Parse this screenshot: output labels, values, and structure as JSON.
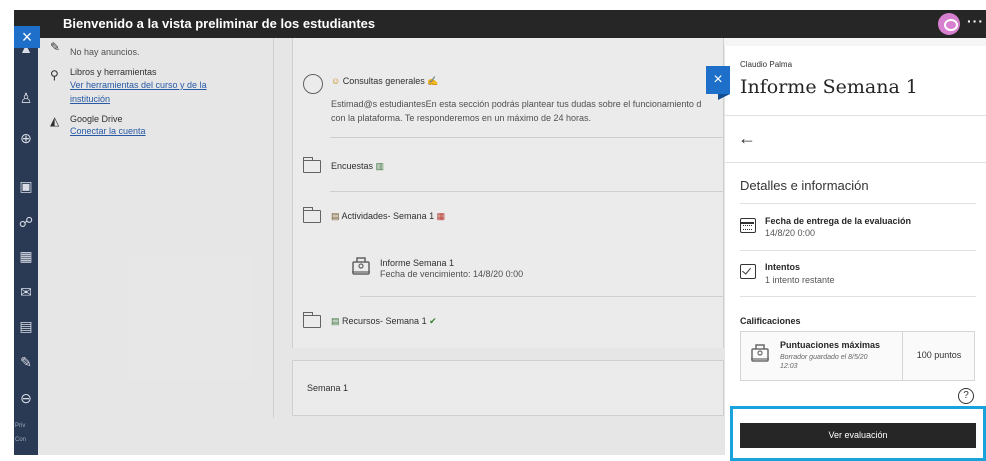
{
  "topbar": {
    "title": "Bienvenido a la vista preliminar de los estudiantes",
    "close_label": "×",
    "more_label": "···"
  },
  "leftnav": {
    "footer_1": "Priv",
    "footer_2": "Con"
  },
  "announcements": {
    "text": "No hay anuncios."
  },
  "tools": {
    "books_title": "Libros y herramientas",
    "books_link_1": "Ver herramientas del curso y de la",
    "books_link_2": "institución",
    "drive_title": "Google Drive",
    "drive_link": "Conectar la cuenta"
  },
  "content": {
    "consultas_title": "Consultas generales",
    "consultas_desc_1": "Estimad@s estudiantesEn esta sección podrás plantear tus dudas sobre el funcionamiento d",
    "consultas_desc_2": "con la plataforma. Te responderemos en un máximo de 24 horas.",
    "encuestas_title": "Encuestas",
    "actividades_title": "Actividades- Semana 1",
    "informe_title": "Informe Semana 1",
    "informe_due": "Fecha de vencimiento: 14/8/20 0:00",
    "recursos_title": "Recursos- Semana 1",
    "semana_title": "Semana 1"
  },
  "side_panel": {
    "close_label": "×",
    "user": "Claudio Palma",
    "title": "Informe Semana 1",
    "back_label": "←",
    "section_title": "Detalles e información",
    "due_label": "Fecha de entrega de la evaluación",
    "due_value": "14/8/20 0:00",
    "attempts_label": "Intentos",
    "attempts_value": "1 intento restante",
    "grades_title": "Calificaciones",
    "grade_label": "Puntuaciones máximas",
    "grade_sub_1": "Borrador guardado el 8/5/20",
    "grade_sub_2": "12:03",
    "grade_points": "100 puntos",
    "help_label": "?",
    "view_button": "Ver evaluación"
  },
  "colors": {
    "accent_blue": "#1d6fc9",
    "topbar": "#262626",
    "leftnav": "#2a3a55",
    "highlight": "#19a3dd",
    "link": "#2a5fb0"
  }
}
